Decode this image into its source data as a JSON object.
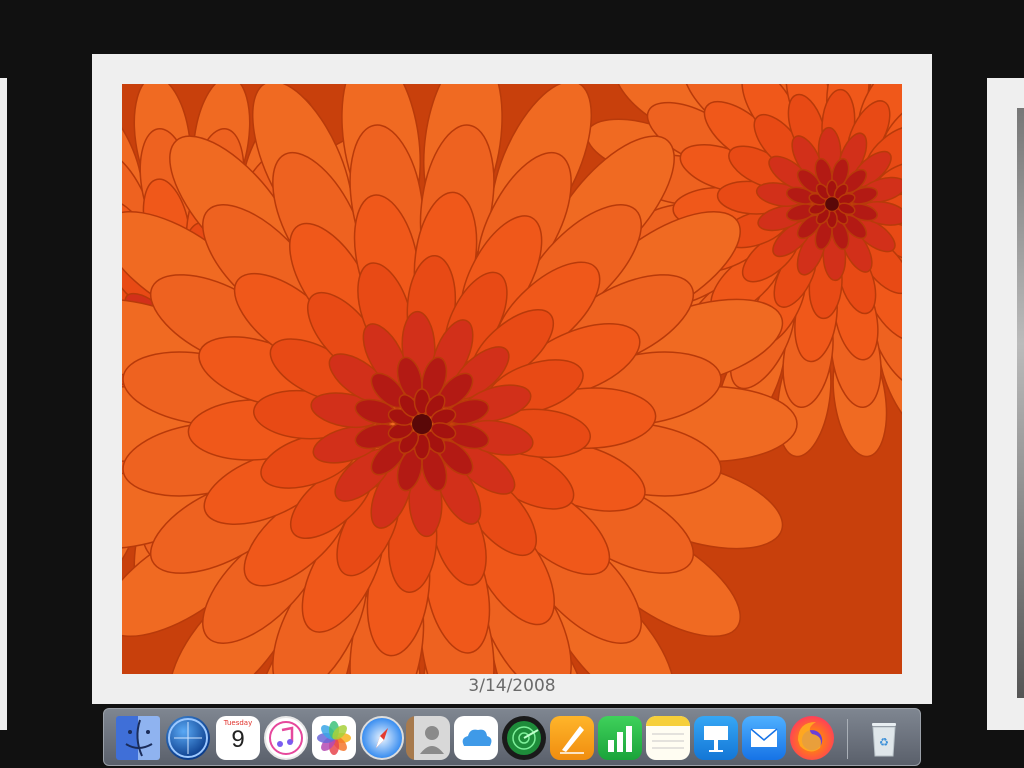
{
  "viewer": {
    "photo_date": "3/14/2008",
    "photo_subject": "orange chrysanthemum flower"
  },
  "calendar_icon": {
    "month": "Tuesday",
    "day": "9"
  },
  "dock": {
    "items": [
      {
        "name": "finder-icon",
        "label": "Finder"
      },
      {
        "name": "screen-saver-icon",
        "label": "Screen Saver"
      },
      {
        "name": "calendar-icon",
        "label": "Calendar"
      },
      {
        "name": "music-icon",
        "label": "Music"
      },
      {
        "name": "photos-icon",
        "label": "Photos"
      },
      {
        "name": "safari-icon",
        "label": "Safari"
      },
      {
        "name": "contacts-icon",
        "label": "Contacts"
      },
      {
        "name": "icloud-icon",
        "label": "iCloud"
      },
      {
        "name": "find-my-icon",
        "label": "Find My"
      },
      {
        "name": "pages-icon",
        "label": "Pages"
      },
      {
        "name": "numbers-icon",
        "label": "Numbers"
      },
      {
        "name": "notes-icon",
        "label": "Notes"
      },
      {
        "name": "keynote-icon",
        "label": "Keynote"
      },
      {
        "name": "mail-icon",
        "label": "Mail"
      },
      {
        "name": "firefox-icon",
        "label": "Firefox"
      },
      {
        "name": "trash-icon",
        "label": "Trash"
      }
    ]
  },
  "colors": {
    "background": "#111111",
    "frame": "#efefef",
    "petal_orange": "#ee5a1a",
    "petal_center": "#a4120f"
  }
}
